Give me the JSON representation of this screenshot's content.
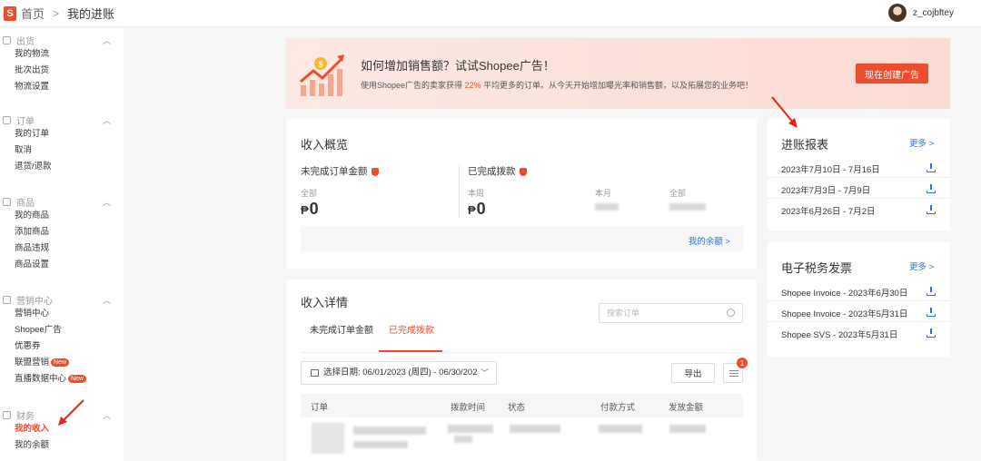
{
  "header": {
    "logo": "S",
    "breadcrumb_home": "首页",
    "breadcrumb_sep": ">",
    "breadcrumb_current": "我的进账",
    "username": "z_cojbftey"
  },
  "sidebar": {
    "groups": [
      {
        "title": "出货",
        "items": [
          "我的物流",
          "批次出货",
          "物流设置"
        ]
      },
      {
        "title": "订单",
        "items": [
          "我的订单",
          "取消",
          "退货/退款"
        ]
      },
      {
        "title": "商品",
        "items": [
          "我的商品",
          "添加商品",
          "商品违规",
          "商品设置"
        ]
      },
      {
        "title": "营销中心",
        "items": [
          "营销中心",
          "Shopee广告",
          "优惠券",
          "联盟营销",
          "直播数据中心"
        ]
      },
      {
        "title": "财务",
        "items": [
          "我的收入",
          "我的余额"
        ]
      }
    ],
    "new_badge": "New"
  },
  "banner": {
    "title": "如何增加销售额？试试Shopee广告！",
    "desc_before": "使用Shopee广告的卖家获得 ",
    "desc_highlight": "22%",
    "desc_after": " 平均更多的订单。从今天开始增加曝光率和销售额，以及拓展您的业务吧！",
    "button": "现在创建广告"
  },
  "overview": {
    "title": "收入概览",
    "pending_label": "未完成订单金额",
    "pending_sub": "全部",
    "pending_value": "0",
    "released_label": "已完成拨款",
    "week_label": "本周",
    "week_value": "0",
    "month_label": "本月",
    "all_label": "全部",
    "currency": "₱",
    "balance_link": "我的余额 >"
  },
  "details": {
    "title": "收入详情",
    "search_placeholder": "搜索订单",
    "tab_pending": "未完成订单金额",
    "tab_released": "已完成拨款",
    "date_label": "选择日期: 06/01/2023 (周四) - 06/30/2023",
    "export": "导出",
    "badge_count": "1",
    "columns": [
      "订单",
      "拨款时间",
      "状态",
      "付款方式",
      "发放金额"
    ]
  },
  "reports": {
    "title": "进账报表",
    "more": "更多 >",
    "items": [
      "2023年7月10日 - 7月16日",
      "2023年7月3日 - 7月9日",
      "2023年6月26日 - 7月2日"
    ]
  },
  "invoices": {
    "title": "电子税务发票",
    "more": "更多 >",
    "items": [
      "Shopee Invoice - 2023年6月30日",
      "Shopee Invoice - 2023年5月31日",
      "Shopee SVS - 2023年5月31日"
    ]
  },
  "colors": {
    "brand": "#ee4d2d",
    "link": "#2673dd"
  }
}
